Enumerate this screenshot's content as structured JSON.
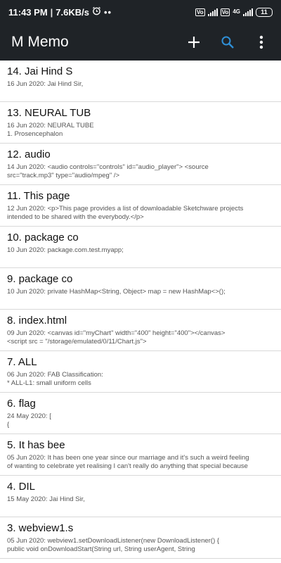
{
  "status": {
    "time": "11:43 PM",
    "speed": "7.6KB/s",
    "sim1_badge": "Vo",
    "sim2_badge": "Vo",
    "net_label": "4G",
    "battery": "11"
  },
  "appbar": {
    "title": "M Memo",
    "icons": [
      "add-icon",
      "search-icon",
      "more-vert-icon"
    ],
    "colors": {
      "bar": "#1f2327",
      "search_accent": "#2f8fd6"
    }
  },
  "memos": [
    {
      "title": "14. Jai Hind S",
      "line1": "16 Jun 2020: Jai Hind Sir,",
      "line2": ""
    },
    {
      "title": "13. NEURAL TUB",
      "line1": "16 Jun 2020: NEURAL TUBE",
      "line2": "1. Prosencephalon"
    },
    {
      "title": "12. audio",
      "line1": "14 Jun 2020: <audio controls=\"controls\" id=\"audio_player\"> <source",
      "line2": "src=\"track.mp3\" type=\"audio/mpeg\" />"
    },
    {
      "title": "11. This page",
      "line1": "12 Jun 2020: <p>This page provides a list of downloadable Sketchware projects",
      "line2": "intended to be shared with the everybody.</p>"
    },
    {
      "title": "10. package co",
      "line1": "10 Jun 2020: package.com.test.myapp;",
      "line2": ""
    },
    {
      "title": "9. package co",
      "line1": "10 Jun 2020: private HashMap<String, Object> map = new HashMap<>();",
      "line2": ""
    },
    {
      "title": "8. index.html",
      "line1": "09 Jun 2020: <canvas id=\"myChart\" width=\"400\" height=\"400\"></canvas>",
      "line2": "<script src = \"/storage/emulated/0/11/Chart.js\">"
    },
    {
      "title": "7. ALL",
      "line1": "06 Jun 2020: FAB Classification:",
      "line2": "* ALL-L1: small uniform cells"
    },
    {
      "title": "6. flag",
      "line1": "24 May 2020: [",
      "line2": "{"
    },
    {
      "title": "5. It has bee",
      "line1": "05 Jun 2020: It has been one year since our marriage and it's such a weird feeling",
      "line2": "of wanting to celebrate yet realising I can't really do anything that special because"
    },
    {
      "title": "4. DIL",
      "line1": "15 May 2020: Jai Hind Sir,",
      "line2": ""
    },
    {
      "title": "3. webview1.s",
      "line1": "05 Jun 2020: webview1.setDownloadListener(new DownloadListener() {",
      "line2": "public void onDownloadStart(String url, String userAgent, String"
    }
  ]
}
